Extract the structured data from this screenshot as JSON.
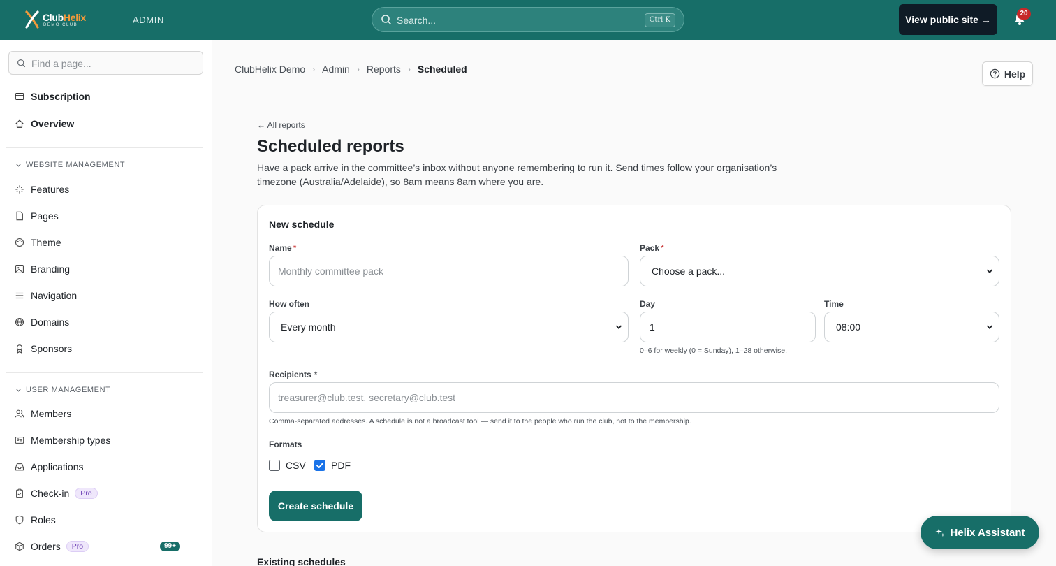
{
  "header": {
    "logo_main": "Club",
    "logo_accent": "Helix",
    "logo_sub": "DEMO CLUB",
    "admin_label": "ADMIN",
    "search_placeholder": "Search...",
    "search_shortcut": "Ctrl K",
    "public_site_label": "View public site →",
    "notification_count": "20"
  },
  "sidebar": {
    "find_placeholder": "Find a page...",
    "top_items": [
      {
        "label": "Subscription",
        "icon": "card-icon"
      },
      {
        "label": "Overview",
        "icon": "home-icon"
      }
    ],
    "website_section": "WEBSITE MANAGEMENT",
    "website_items": [
      {
        "label": "Features",
        "icon": "sparkle-icon"
      },
      {
        "label": "Pages",
        "icon": "page-icon"
      },
      {
        "label": "Theme",
        "icon": "palette-icon"
      },
      {
        "label": "Branding",
        "icon": "image-icon"
      },
      {
        "label": "Navigation",
        "icon": "menu-icon"
      },
      {
        "label": "Domains",
        "icon": "globe-icon"
      },
      {
        "label": "Sponsors",
        "icon": "award-icon"
      }
    ],
    "user_section": "USER MANAGEMENT",
    "user_items": [
      {
        "label": "Members",
        "icon": "users-icon"
      },
      {
        "label": "Membership types",
        "icon": "id-card-icon"
      },
      {
        "label": "Applications",
        "icon": "inbox-icon"
      },
      {
        "label": "Check-in",
        "icon": "clipboard-check-icon",
        "badge": "Pro"
      },
      {
        "label": "Roles",
        "icon": "shield-icon"
      },
      {
        "label": "Orders",
        "icon": "box-icon",
        "badge": "Pro",
        "count": "99+"
      }
    ]
  },
  "breadcrumb": [
    "ClubHelix Demo",
    "Admin",
    "Reports",
    "Scheduled"
  ],
  "help_label": "Help",
  "page": {
    "back_link": "← All reports",
    "title": "Scheduled reports",
    "intro": "Have a pack arrive in the committee’s inbox without anyone remembering to run it. Send times follow your organisation’s timezone (Australia/Adelaide), so 8am means 8am where you are."
  },
  "form": {
    "card_title": "New schedule",
    "name_label": "Name",
    "name_placeholder": "Monthly committee pack",
    "pack_label": "Pack",
    "pack_value": "Choose a pack...",
    "how_often_label": "How often",
    "how_often_value": "Every month",
    "day_label": "Day",
    "day_value": "1",
    "day_hint": "0–6 for weekly (0 = Sunday), 1–28 otherwise.",
    "time_label": "Time",
    "time_value": "08:00",
    "recipients_label": "Recipients",
    "recipients_placeholder": "treasurer@club.test, secretary@club.test",
    "recipients_hint": "Comma-separated addresses. A schedule is not a broadcast tool — send it to the people who run the club, not to the membership.",
    "formats_label": "Formats",
    "formats": [
      {
        "label": "CSV",
        "checked": false
      },
      {
        "label": "PDF",
        "checked": true
      }
    ],
    "required_mark": "*",
    "submit_label": "Create schedule"
  },
  "existing_title": "Existing schedules",
  "assistant_label": "Helix Assistant",
  "colors": {
    "brand": "#176e68",
    "accent": "#f29a3b",
    "checkbox": "#1a73e8",
    "badge": "#c62828"
  }
}
